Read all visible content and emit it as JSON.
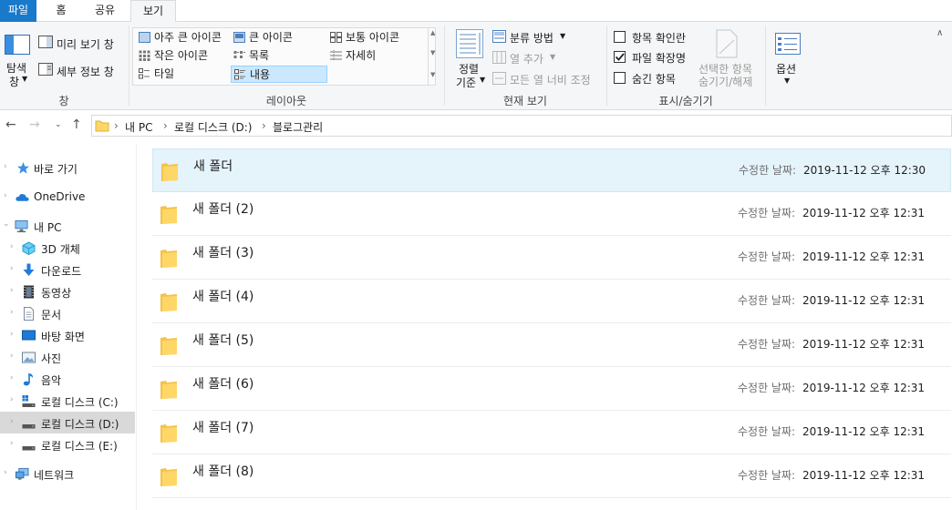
{
  "tabs": {
    "file": "파일",
    "home": "홈",
    "share": "공유",
    "view": "보기"
  },
  "ribbon": {
    "pane_group": {
      "nav_pane_label": "탐색\n창",
      "nav_pane_line1": "탐색",
      "nav_pane_line2": "창",
      "preview": "미리 보기 창",
      "details": "세부 정보 창",
      "group_label": "창"
    },
    "layout_group": {
      "items": [
        "아주 큰 아이콘",
        "큰 아이콘",
        "보통 아이콘",
        "작은 아이콘",
        "목록",
        "자세히",
        "타일",
        "내용"
      ],
      "selected": "내용",
      "group_label": "레이아웃"
    },
    "current_view_group": {
      "sort_line1": "정렬",
      "sort_line2": "기준",
      "group_by": "분류 방법",
      "add_column": "열 추가",
      "fit_columns": "모든 열 너비 조정",
      "group_label": "현재 보기"
    },
    "show_hide_group": {
      "item_checkboxes": "항목 확인란",
      "item_checkboxes_checked": false,
      "file_extensions": "파일 확장명",
      "file_extensions_checked": true,
      "hidden_items": "숨긴 항목",
      "hidden_items_checked": false,
      "hide_selected_line1": "선택한 항목",
      "hide_selected_line2": "숨기기/해제",
      "group_label": "표시/숨기기"
    },
    "options": {
      "label": "옵션"
    }
  },
  "address": {
    "crumbs": [
      "내 PC",
      "로컬 디스크 (D:)",
      "블로그관리"
    ]
  },
  "nav_tree": [
    {
      "label": "바로 가기",
      "icon": "star-icon"
    },
    {
      "label": "OneDrive",
      "icon": "cloud-icon"
    },
    {
      "label": "내 PC",
      "icon": "computer-icon"
    },
    {
      "label": "3D 개체",
      "icon": "cube-icon"
    },
    {
      "label": "다운로드",
      "icon": "download-icon"
    },
    {
      "label": "동영상",
      "icon": "film-icon"
    },
    {
      "label": "문서",
      "icon": "document-icon"
    },
    {
      "label": "바탕 화면",
      "icon": "desktop-icon"
    },
    {
      "label": "사진",
      "icon": "pictures-icon"
    },
    {
      "label": "음악",
      "icon": "music-icon"
    },
    {
      "label": "로컬 디스크 (C:)",
      "icon": "drive-icon"
    },
    {
      "label": "로컬 디스크 (D:)",
      "icon": "drive-icon"
    },
    {
      "label": "로컬 디스크 (E:)",
      "icon": "drive-icon"
    },
    {
      "label": "네트워크",
      "icon": "network-icon"
    }
  ],
  "files": {
    "date_label": "수정한 날짜:",
    "items": [
      {
        "name": "새 폴더",
        "date": "2019-11-12 오후 12:30"
      },
      {
        "name": "새 폴더 (2)",
        "date": "2019-11-12 오후 12:31"
      },
      {
        "name": "새 폴더 (3)",
        "date": "2019-11-12 오후 12:31"
      },
      {
        "name": "새 폴더 (4)",
        "date": "2019-11-12 오후 12:31"
      },
      {
        "name": "새 폴더 (5)",
        "date": "2019-11-12 오후 12:31"
      },
      {
        "name": "새 폴더 (6)",
        "date": "2019-11-12 오후 12:31"
      },
      {
        "name": "새 폴더 (7)",
        "date": "2019-11-12 오후 12:31"
      },
      {
        "name": "새 폴더 (8)",
        "date": "2019-11-12 오후 12:31"
      }
    ]
  },
  "colors": {
    "accent": "#1979ca",
    "folder": "#ffd766",
    "selection": "#e5f3fb"
  }
}
